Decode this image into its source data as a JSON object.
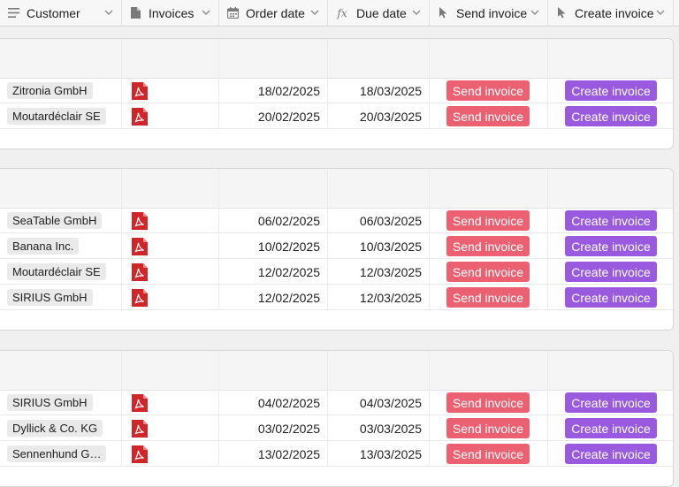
{
  "columns": {
    "customer": "Customer",
    "invoices": "Invoices",
    "order_date": "Order date",
    "due_date": "Due date",
    "send_invoice": "Send invoice",
    "create_invoice": "Create invoice"
  },
  "icons": {
    "customer": "list-icon",
    "invoices": "file-icon",
    "order_date": "calendar-icon",
    "due_date": "formula-icon",
    "send_invoice": "cursor-icon",
    "create_invoice": "cursor-icon",
    "attachment": "pdf-icon"
  },
  "colors": {
    "send_button": "#eb6172",
    "create_button": "#9a5ae0",
    "pdf": "#d0262a"
  },
  "groups": [
    {
      "rows": [
        {
          "customer": "Zitronia GmbH",
          "order_date": "18/02/2025",
          "due_date": "18/03/2025",
          "send_label": "Send invoice",
          "create_label": "Create invoice"
        },
        {
          "customer": "Moutardéclair SE",
          "order_date": "20/02/2025",
          "due_date": "20/03/2025",
          "send_label": "Send invoice",
          "create_label": "Create invoice"
        }
      ]
    },
    {
      "rows": [
        {
          "customer": "SeaTable GmbH",
          "order_date": "06/02/2025",
          "due_date": "06/03/2025",
          "send_label": "Send invoice",
          "create_label": "Create invoice"
        },
        {
          "customer": "Banana Inc.",
          "order_date": "10/02/2025",
          "due_date": "10/03/2025",
          "send_label": "Send invoice",
          "create_label": "Create invoice"
        },
        {
          "customer": "Moutardéclair SE",
          "order_date": "12/02/2025",
          "due_date": "12/03/2025",
          "send_label": "Send invoice",
          "create_label": "Create invoice"
        },
        {
          "customer": "SIRIUS GmbH",
          "order_date": "12/02/2025",
          "due_date": "12/03/2025",
          "send_label": "Send invoice",
          "create_label": "Create invoice"
        }
      ]
    },
    {
      "rows": [
        {
          "customer": "SIRIUS GmbH",
          "order_date": "04/02/2025",
          "due_date": "04/03/2025",
          "send_label": "Send invoice",
          "create_label": "Create invoice"
        },
        {
          "customer": "Dyllick & Co. KG",
          "order_date": "03/02/2025",
          "due_date": "03/03/2025",
          "send_label": "Send invoice",
          "create_label": "Create invoice"
        },
        {
          "customer": "Sennenhund G…",
          "order_date": "13/02/2025",
          "due_date": "13/03/2025",
          "send_label": "Send invoice",
          "create_label": "Create invoice"
        }
      ]
    }
  ]
}
